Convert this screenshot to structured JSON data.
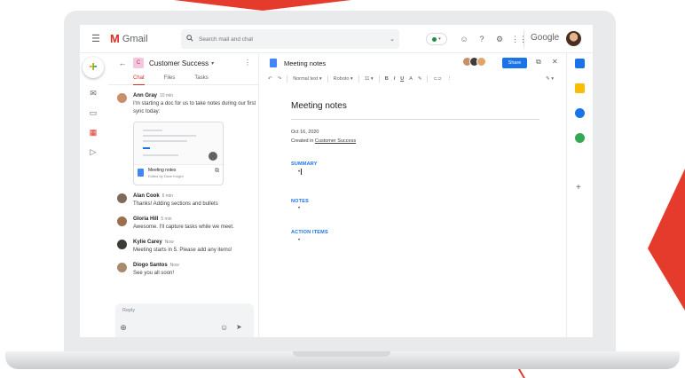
{
  "colors": {
    "accent_red": "#d93025",
    "primary_blue": "#1a73e8",
    "brand_red": "#e53b2c"
  },
  "topbar": {
    "app_name": "Gmail",
    "search_placeholder": "Search mail and chat",
    "google_wordmark": "Google",
    "icons": [
      "menu-icon",
      "search-icon",
      "help-icon",
      "settings-icon",
      "apps-icon"
    ]
  },
  "chat": {
    "room_letter": "C",
    "room_name": "Customer Success",
    "tabs": [
      "Chat",
      "Files",
      "Tasks"
    ],
    "messages": [
      {
        "author": "Ann Gray",
        "time": "10 min",
        "text": "I'm starting a doc for us to take notes during our first sync today:"
      },
      {
        "author": "Alan Cook",
        "time": "6 min",
        "text": "Thanks! Adding sections and bullets"
      },
      {
        "author": "Gloria Hill",
        "time": "5 min",
        "text": "Awesome. I'll capture tasks while we meet."
      },
      {
        "author": "Kylie Carey",
        "time": "Now",
        "text": "Meeting starts in 5. Please add any items!"
      },
      {
        "author": "Diogo Santos",
        "time": "Now",
        "text": "See you all soon!"
      }
    ],
    "doc_card": {
      "title": "Meeting notes",
      "subtitle": "Edited by Dave Knight"
    },
    "reply_placeholder": "Reply"
  },
  "doc": {
    "title": "Meeting notes",
    "share_label": "Share",
    "toolbar": {
      "style": "Normal text",
      "font": "Roboto",
      "size": "11"
    },
    "page": {
      "heading": "Meeting notes",
      "date": "Oct 16, 2020",
      "created_prefix": "Created in",
      "created_link": "Customer Success",
      "sections": [
        "SUMMARY",
        "NOTES",
        "ACTION ITEMS"
      ]
    }
  }
}
